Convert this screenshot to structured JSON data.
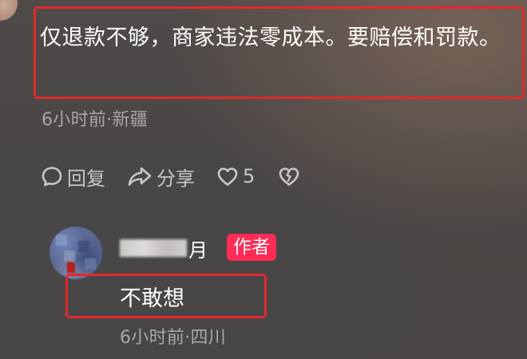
{
  "comment": {
    "text": "仅退款不够，商家违法零成本。要赔偿和罚款。",
    "meta": "6小时前·新疆",
    "actions": {
      "reply_label": "回复",
      "share_label": "分享",
      "like_count": "5"
    }
  },
  "reply": {
    "author_name_visible": "月",
    "author_badge": "作者",
    "text": "不敢想",
    "meta": "6小时前·四川"
  },
  "colors": {
    "highlight_box": "#e3282a",
    "author_badge": "#fe2c55",
    "text_primary": "#ffffff",
    "text_secondary": "#a9a6a5"
  },
  "icons": [
    "comment-bubble-icon",
    "share-arrow-icon",
    "heart-icon",
    "broken-heart-icon"
  ]
}
